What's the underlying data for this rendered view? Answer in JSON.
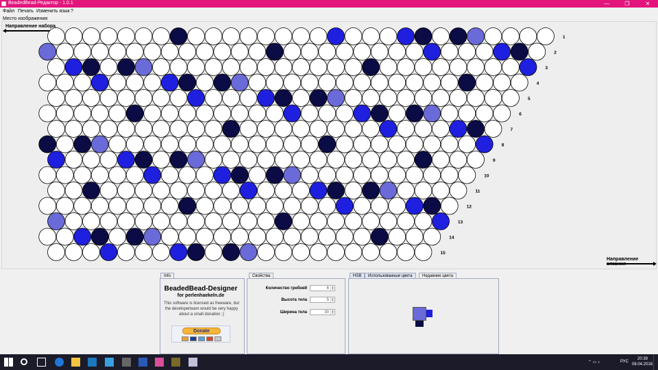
{
  "window": {
    "title": "BeadedBead-Редактор - 1.0.1",
    "minimize": "—",
    "maximize": "❐",
    "close": "✕",
    "accent": "#e3157d"
  },
  "menu": {
    "file": "Файл",
    "print": "Печать",
    "language": "Изменить язык",
    "help": "?"
  },
  "canvas": {
    "label": "Место изображения",
    "set_direction": "Направление набора",
    "knit_direction": "Направление вязания"
  },
  "pattern": {
    "colors": {
      "W": "#ffffff",
      "N": "#0b0b45",
      "B": "#1f1fe0",
      "L": "#6a6ad8"
    },
    "row_numbers": [
      "1",
      "2",
      "3",
      "4",
      "5",
      "6",
      "7",
      "8",
      "9",
      "10",
      "11",
      "12",
      "13",
      "14",
      "15"
    ]
  },
  "info_panel": {
    "tab": "Info",
    "title": "BeadedBead-Designer",
    "subtitle": "for perlenhaekeln.de",
    "text": "This software is licensed as freeware, but the developerteam would be very happy about a small donation ;)",
    "donate": "Donate"
  },
  "properties": {
    "tab": "Свойства",
    "ribs_label": "Количество гребней",
    "ribs_value": "6",
    "height_label": "Высота тела",
    "height_value": "5",
    "width_label": "Ширина тела",
    "width_value": "30"
  },
  "colors_panel": {
    "tab_hsb": "HSB",
    "tab_used": "Использованные цвета",
    "tab_recent": "Недавние цвета"
  },
  "taskbar": {
    "lang": "РУС",
    "time": "20:39",
    "date": "08.04.2016"
  }
}
